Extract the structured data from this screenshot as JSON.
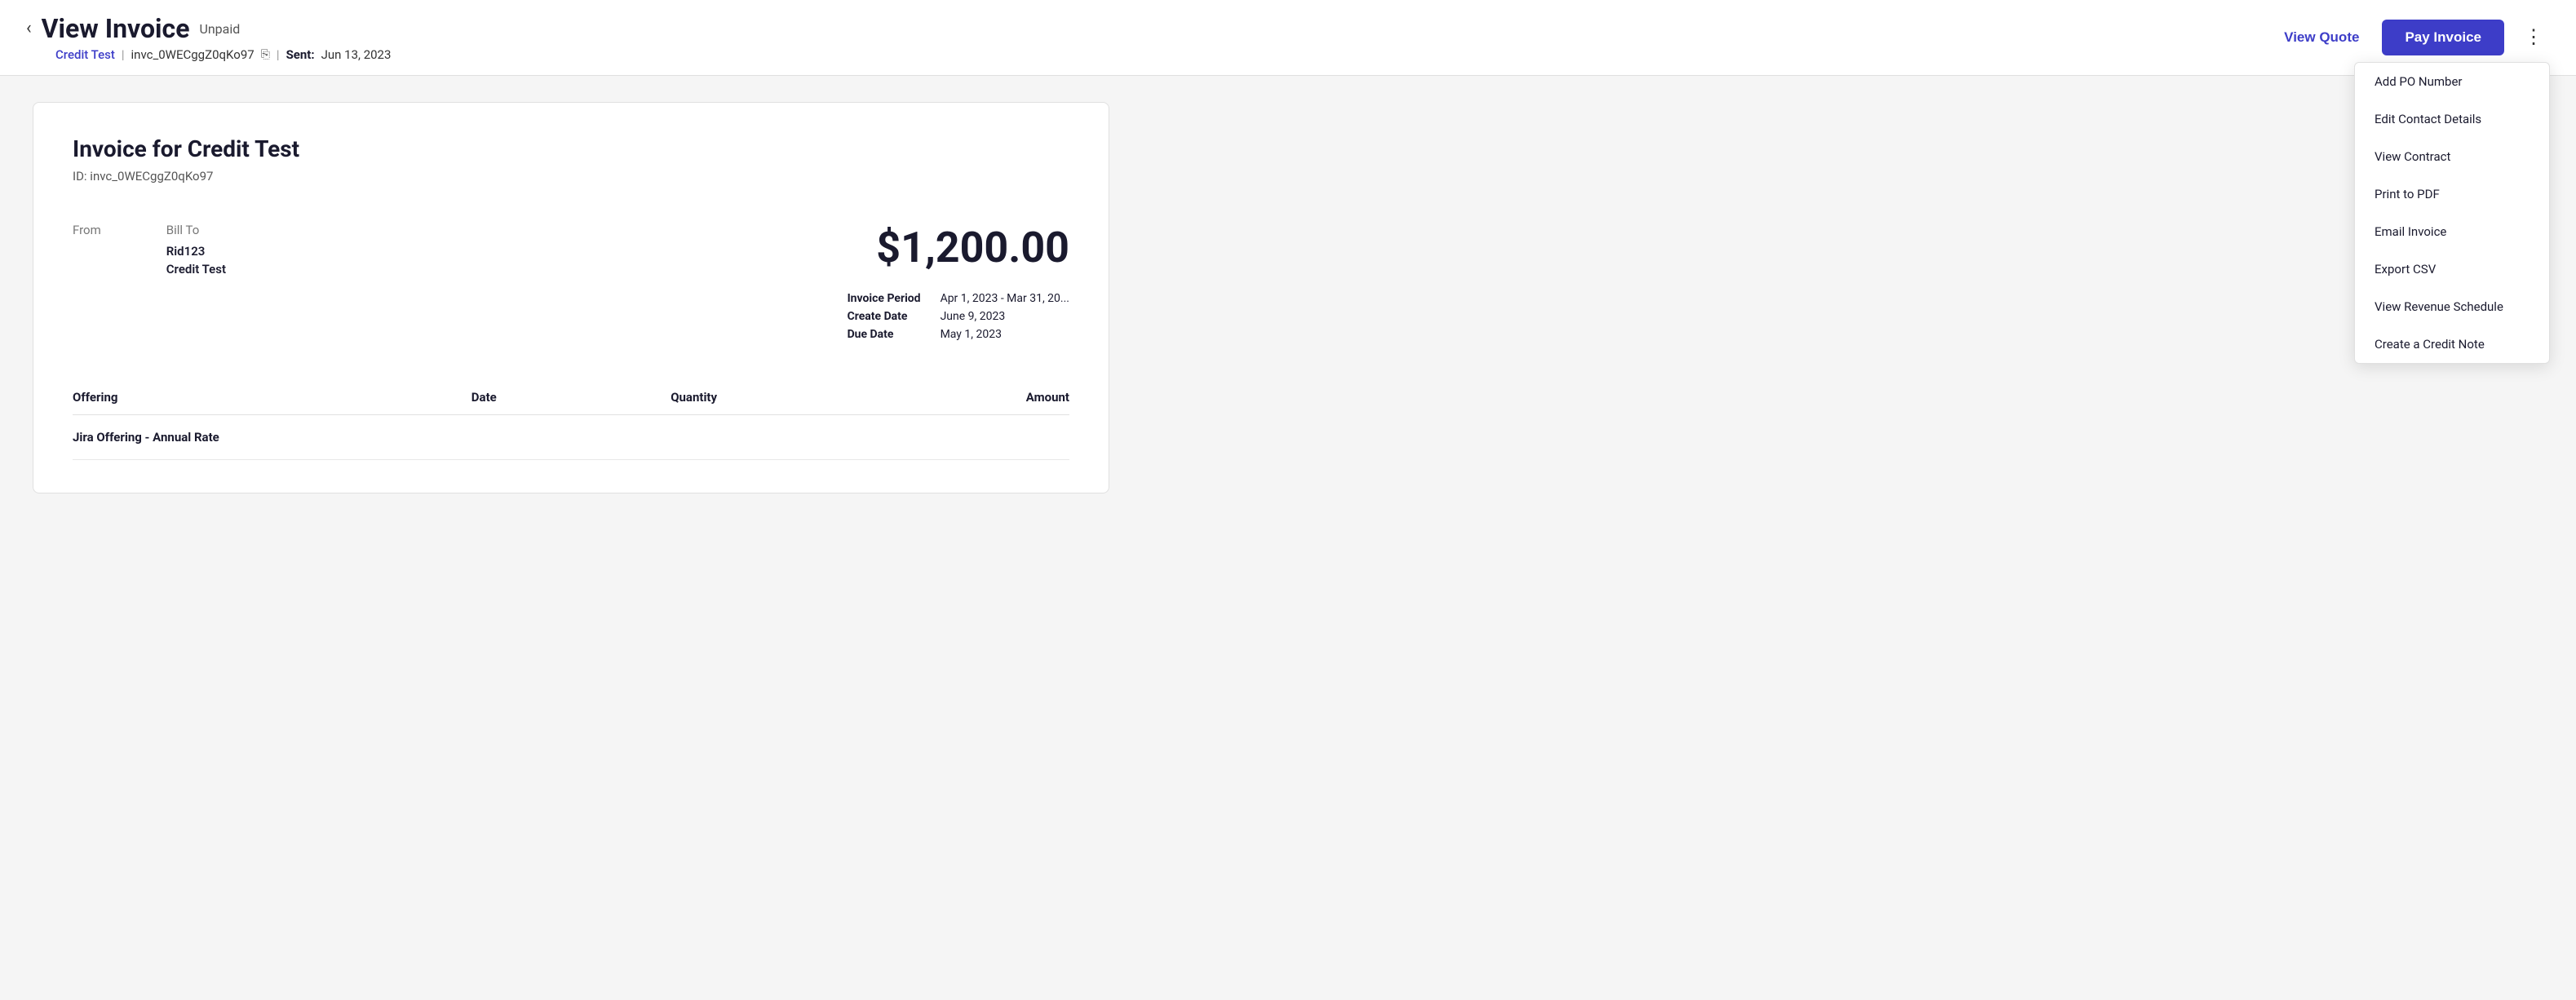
{
  "header": {
    "back_label": "‹",
    "title": "View Invoice",
    "status": "Unpaid",
    "credit_link": "Credit Test",
    "invoice_id": "invc_0WECggZ0qKo97",
    "sent_label": "Sent:",
    "sent_date": "Jun 13, 2023",
    "view_quote_label": "View Quote",
    "pay_invoice_label": "Pay Invoice",
    "three_dots": "⋮"
  },
  "dropdown": {
    "items": [
      "Add PO Number",
      "Edit Contact Details",
      "View Contract",
      "Print to PDF",
      "Email Invoice",
      "Export CSV",
      "View Revenue Schedule",
      "Create a Credit Note"
    ]
  },
  "invoice": {
    "title": "Invoice for Credit Test",
    "id_label": "ID:",
    "id_value": "invc_0WECggZ0qKo97",
    "from_label": "From",
    "bill_to_label": "Bill To",
    "bill_to_name": "Rid123",
    "bill_to_company": "Credit Test",
    "amount": "$1,200.00",
    "invoice_period_label": "Invoice Period",
    "invoice_period_value": "Apr 1, 2023 - Mar 31, 20...",
    "create_date_label": "Create Date",
    "create_date_value": "June 9, 2023",
    "due_date_label": "Due Date",
    "due_date_value": "May 1, 2023"
  },
  "table": {
    "columns": [
      "Offering",
      "Date",
      "Quantity",
      "Amount"
    ],
    "rows": [
      {
        "offering": "Jira Offering - Annual Rate",
        "date": "",
        "quantity": "",
        "amount": ""
      }
    ]
  }
}
